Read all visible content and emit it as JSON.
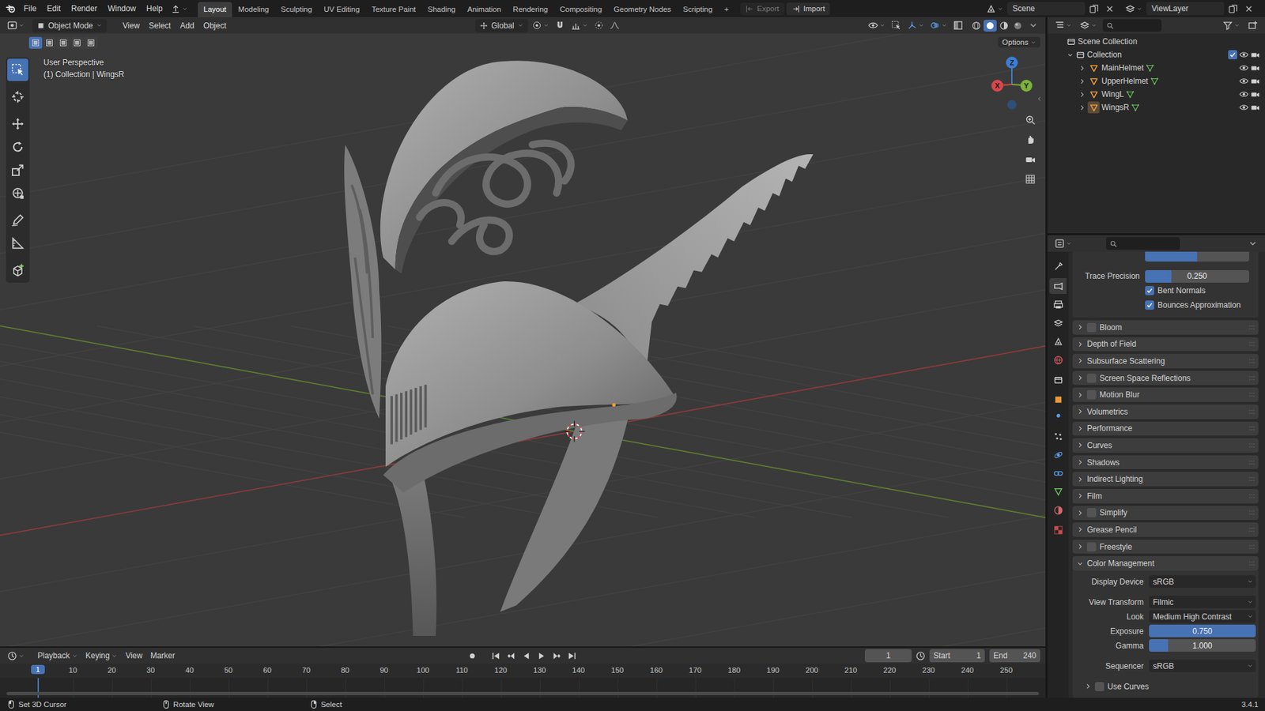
{
  "topbar": {
    "menus": [
      "File",
      "Edit",
      "Render",
      "Window",
      "Help"
    ],
    "workspaces": [
      {
        "label": "Layout",
        "selected": true
      },
      {
        "label": "Modeling",
        "selected": false
      },
      {
        "label": "Sculpting",
        "selected": false
      },
      {
        "label": "UV Editing",
        "selected": false
      },
      {
        "label": "Texture Paint",
        "selected": false
      },
      {
        "label": "Shading",
        "selected": false
      },
      {
        "label": "Animation",
        "selected": false
      },
      {
        "label": "Rendering",
        "selected": false
      },
      {
        "label": "Compositing",
        "selected": false
      },
      {
        "label": "Geometry Nodes",
        "selected": false
      },
      {
        "label": "Scripting",
        "selected": false
      }
    ],
    "add_workspace": "+",
    "actions": [
      {
        "label": "Export",
        "disabled": true
      },
      {
        "label": "Import",
        "disabled": false
      }
    ],
    "scene": "Scene",
    "view_layer": "ViewLayer"
  },
  "viewport": {
    "mode": "Object Mode",
    "menus": [
      "View",
      "Select",
      "Add",
      "Object"
    ],
    "orientation": "Global",
    "options": "Options",
    "info": [
      "User Perspective",
      "(1) Collection | WingsR"
    ],
    "gizmo_axes": {
      "x": "X",
      "y": "Y",
      "z": "Z"
    },
    "tools": [
      {
        "kind": "select",
        "selected": true
      },
      {
        "kind": "cursor",
        "selected": false
      },
      {
        "kind": "move",
        "selected": false
      },
      {
        "kind": "rotate",
        "selected": false
      },
      {
        "kind": "scale",
        "selected": false
      },
      {
        "kind": "transform",
        "selected": false
      },
      {
        "kind": "annotate",
        "selected": false
      },
      {
        "kind": "measure",
        "selected": false
      },
      {
        "kind": "add",
        "selected": false
      }
    ],
    "shading_modes": [
      {
        "kind": "wireframe",
        "selected": false
      },
      {
        "kind": "solid",
        "selected": true
      },
      {
        "kind": "material",
        "selected": false
      },
      {
        "kind": "rendered",
        "selected": false
      }
    ]
  },
  "outliner": {
    "root": "Scene Collection",
    "collection": {
      "name": "Collection",
      "checked": true,
      "expanded": true
    },
    "objects": [
      {
        "name": "MainHelmet",
        "active": false,
        "expanded": false
      },
      {
        "name": "UpperHelmet",
        "active": false,
        "expanded": false
      },
      {
        "name": "WingL",
        "active": false,
        "expanded": false
      },
      {
        "name": "WingsR",
        "active": true,
        "expanded": false
      }
    ]
  },
  "properties": {
    "tab_groups": [
      [
        {
          "kind": "tool",
          "selected": false
        }
      ],
      [
        {
          "kind": "render",
          "selected": true
        },
        {
          "kind": "output",
          "selected": false
        },
        {
          "kind": "view_layer",
          "selected": false
        },
        {
          "kind": "scene",
          "selected": false
        },
        {
          "kind": "world",
          "selected": false
        }
      ],
      [
        {
          "kind": "collection",
          "selected": false
        }
      ],
      [
        {
          "kind": "object",
          "selected": false
        },
        {
          "kind": "modifiers",
          "selected": false
        },
        {
          "kind": "particles",
          "selected": false
        },
        {
          "kind": "physics",
          "selected": false
        },
        {
          "kind": "constraints",
          "selected": false
        },
        {
          "kind": "data",
          "selected": false
        },
        {
          "kind": "material",
          "selected": false
        }
      ],
      [
        {
          "kind": "texture",
          "selected": false
        }
      ]
    ],
    "cut_slider_level": 0.5,
    "trace_precision": {
      "label": "Trace Precision",
      "value": "0.250",
      "level": 0.25
    },
    "toggles": [
      {
        "label": "Bent Normals",
        "checked": true
      },
      {
        "label": "Bounces Approximation",
        "checked": true
      }
    ],
    "panels": [
      {
        "label": "Bloom",
        "kind": "toggle",
        "checked": false,
        "expanded": false
      },
      {
        "label": "Depth of Field",
        "kind": "plain",
        "expanded": false
      },
      {
        "label": "Subsurface Scattering",
        "kind": "plain",
        "expanded": false
      },
      {
        "label": "Screen Space Reflections",
        "kind": "toggle",
        "checked": false,
        "expanded": false
      },
      {
        "label": "Motion Blur",
        "kind": "toggle",
        "checked": false,
        "expanded": false
      },
      {
        "label": "Volumetrics",
        "kind": "plain",
        "expanded": false
      },
      {
        "label": "Performance",
        "kind": "plain",
        "expanded": false
      },
      {
        "label": "Curves",
        "kind": "plain",
        "expanded": false
      },
      {
        "label": "Shadows",
        "kind": "plain",
        "expanded": false
      },
      {
        "label": "Indirect Lighting",
        "kind": "plain",
        "expanded": false
      },
      {
        "label": "Film",
        "kind": "plain",
        "expanded": false
      },
      {
        "label": "Simplify",
        "kind": "toggle",
        "checked": false,
        "expanded": false
      },
      {
        "label": "Grease Pencil",
        "kind": "plain",
        "expanded": false
      },
      {
        "label": "Freestyle",
        "kind": "toggle",
        "checked": false,
        "expanded": false
      }
    ],
    "color_management": {
      "label": "Color Management",
      "expanded": true,
      "groups": [
        [
          {
            "kind": "dropdown",
            "label": "Display Device",
            "value": "sRGB"
          }
        ],
        [
          {
            "kind": "dropdown",
            "label": "View Transform",
            "value": "Filmic"
          },
          {
            "kind": "dropdown",
            "label": "Look",
            "value": "Medium High Contrast"
          },
          {
            "kind": "slider",
            "label": "Exposure",
            "value": "0.750",
            "level": 1
          },
          {
            "kind": "slider",
            "label": "Gamma",
            "value": "1.000",
            "level": 0.18
          }
        ],
        [
          {
            "kind": "dropdown",
            "label": "Sequencer",
            "value": "sRGB"
          }
        ]
      ],
      "use_curves": {
        "label": "Use Curves",
        "checked": false,
        "expanded": false
      }
    }
  },
  "timeline": {
    "menus": [
      "Playback",
      "Keying",
      "View",
      "Marker"
    ],
    "current_frame": "1",
    "start_label": "Start",
    "start": "1",
    "end_label": "End",
    "end": "240",
    "playhead": "1",
    "ticks": [
      "10",
      "20",
      "30",
      "40",
      "50",
      "60",
      "70",
      "80",
      "90",
      "100",
      "110",
      "120",
      "130",
      "140",
      "150",
      "160",
      "170",
      "180",
      "190",
      "200",
      "210",
      "220",
      "230",
      "240",
      "250"
    ]
  },
  "status_bar": {
    "hints": [
      "Set 3D Cursor",
      "Rotate View",
      "Select"
    ],
    "version": "3.4.1"
  }
}
